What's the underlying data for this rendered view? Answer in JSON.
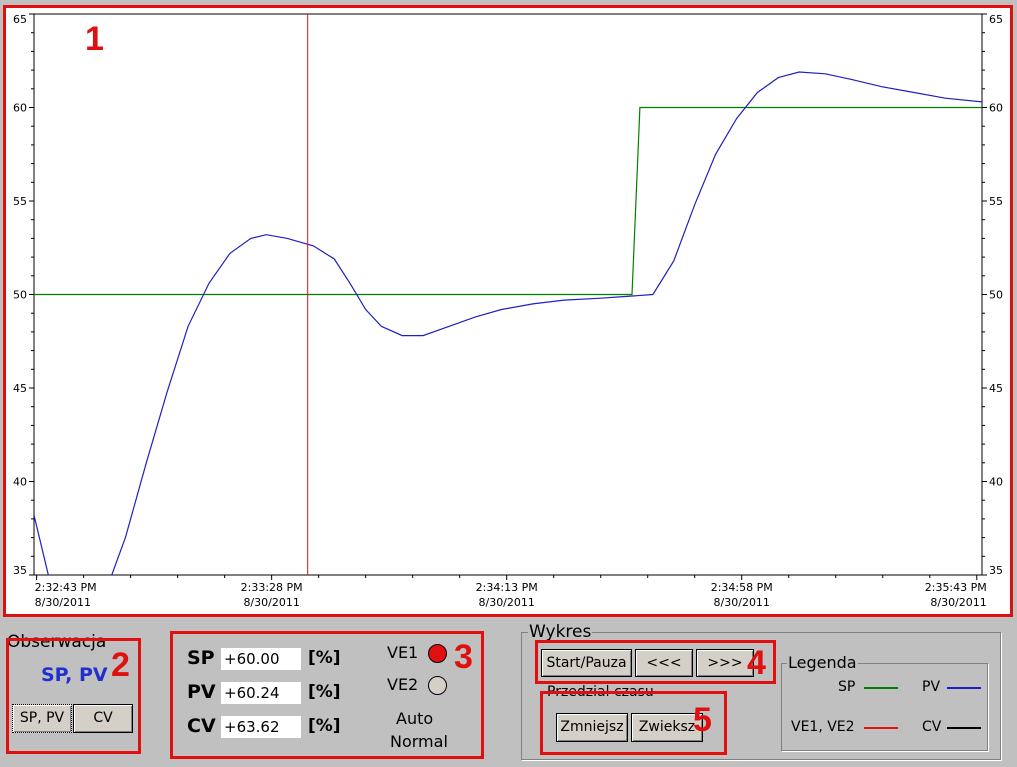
{
  "chart_area": {
    "marker": "1"
  },
  "chart_data": {
    "type": "line",
    "ylim": [
      35,
      65
    ],
    "yticks": [
      "65",
      "60",
      "55",
      "50",
      "45",
      "40",
      "35"
    ],
    "xticks": [
      {
        "time": "2:32:43 PM",
        "date": "8/30/2011"
      },
      {
        "time": "2:33:28 PM",
        "date": "8/30/2011"
      },
      {
        "time": "2:34:13 PM",
        "date": "8/30/2011"
      },
      {
        "time": "2:34:58 PM",
        "date": "8/30/2011"
      },
      {
        "time": "2:35:43 PM",
        "date": "8/30/2011"
      }
    ],
    "x_domain_seconds": [
      -0.5,
      181
    ],
    "grid": false,
    "series": [
      {
        "name": "SP",
        "color": "#008000",
        "points": [
          [
            -0.5,
            50
          ],
          [
            114,
            50
          ],
          [
            115.5,
            60
          ],
          [
            181,
            60
          ]
        ]
      },
      {
        "name": "PV",
        "color": "#2020c0",
        "points": [
          [
            -0.5,
            38.2
          ],
          [
            2.5,
            34.7
          ],
          [
            14,
            34.7
          ],
          [
            17,
            37
          ],
          [
            21,
            41
          ],
          [
            25,
            44.8
          ],
          [
            29,
            48.3
          ],
          [
            33,
            50.6
          ],
          [
            37,
            52.2
          ],
          [
            41,
            53.0
          ],
          [
            44,
            53.2
          ],
          [
            48,
            53.0
          ],
          [
            53,
            52.6
          ],
          [
            57,
            51.9
          ],
          [
            60,
            50.6
          ],
          [
            63,
            49.2
          ],
          [
            66,
            48.3
          ],
          [
            70,
            47.8
          ],
          [
            74,
            47.8
          ],
          [
            79,
            48.3
          ],
          [
            84,
            48.8
          ],
          [
            89,
            49.2
          ],
          [
            95,
            49.5
          ],
          [
            101,
            49.7
          ],
          [
            108,
            49.8
          ],
          [
            113,
            49.9
          ],
          [
            118,
            50.0
          ],
          [
            122,
            51.8
          ],
          [
            126,
            54.8
          ],
          [
            130,
            57.5
          ],
          [
            134,
            59.4
          ],
          [
            138,
            60.8
          ],
          [
            142,
            61.6
          ],
          [
            146,
            61.9
          ],
          [
            151,
            61.8
          ],
          [
            156,
            61.5
          ],
          [
            162,
            61.1
          ],
          [
            168,
            60.8
          ],
          [
            174,
            60.5
          ],
          [
            181,
            60.3
          ]
        ]
      }
    ],
    "cursor": {
      "x": 51.9,
      "color": "#e01010"
    }
  },
  "observation": {
    "title": "Obserwacja",
    "current": "SP, PV",
    "btn_sppv": "SP, PV",
    "btn_cv": "CV",
    "marker": "2"
  },
  "values": {
    "marker": "3",
    "sp_label": "SP",
    "sp_value": "+60.00",
    "sp_unit": "[%]",
    "pv_label": "PV",
    "pv_value": "+60.24",
    "pv_unit": "[%]",
    "cv_label": "CV",
    "cv_value": "+63.62",
    "cv_unit": "[%]",
    "ve1_label": "VE1",
    "ve2_label": "VE2",
    "mode1": "Auto",
    "mode2": "Normal"
  },
  "wykres": {
    "title": "Wykres",
    "btn_start": "Start/Pauza",
    "btn_back": "<<<",
    "btn_fwd": ">>>",
    "marker4": "4",
    "interval_title": "Przedzial czasu",
    "btn_decrease": "Zmniejsz",
    "btn_increase": "Zwieksz",
    "marker5": "5"
  },
  "legend": {
    "title": "Legenda",
    "sp": "SP",
    "pv": "PV",
    "ve": "VE1, VE2",
    "cv": "CV",
    "sp_color": "#008000",
    "pv_color": "#2020c0",
    "ve_color": "#e01010",
    "cv_color": "#000000"
  }
}
